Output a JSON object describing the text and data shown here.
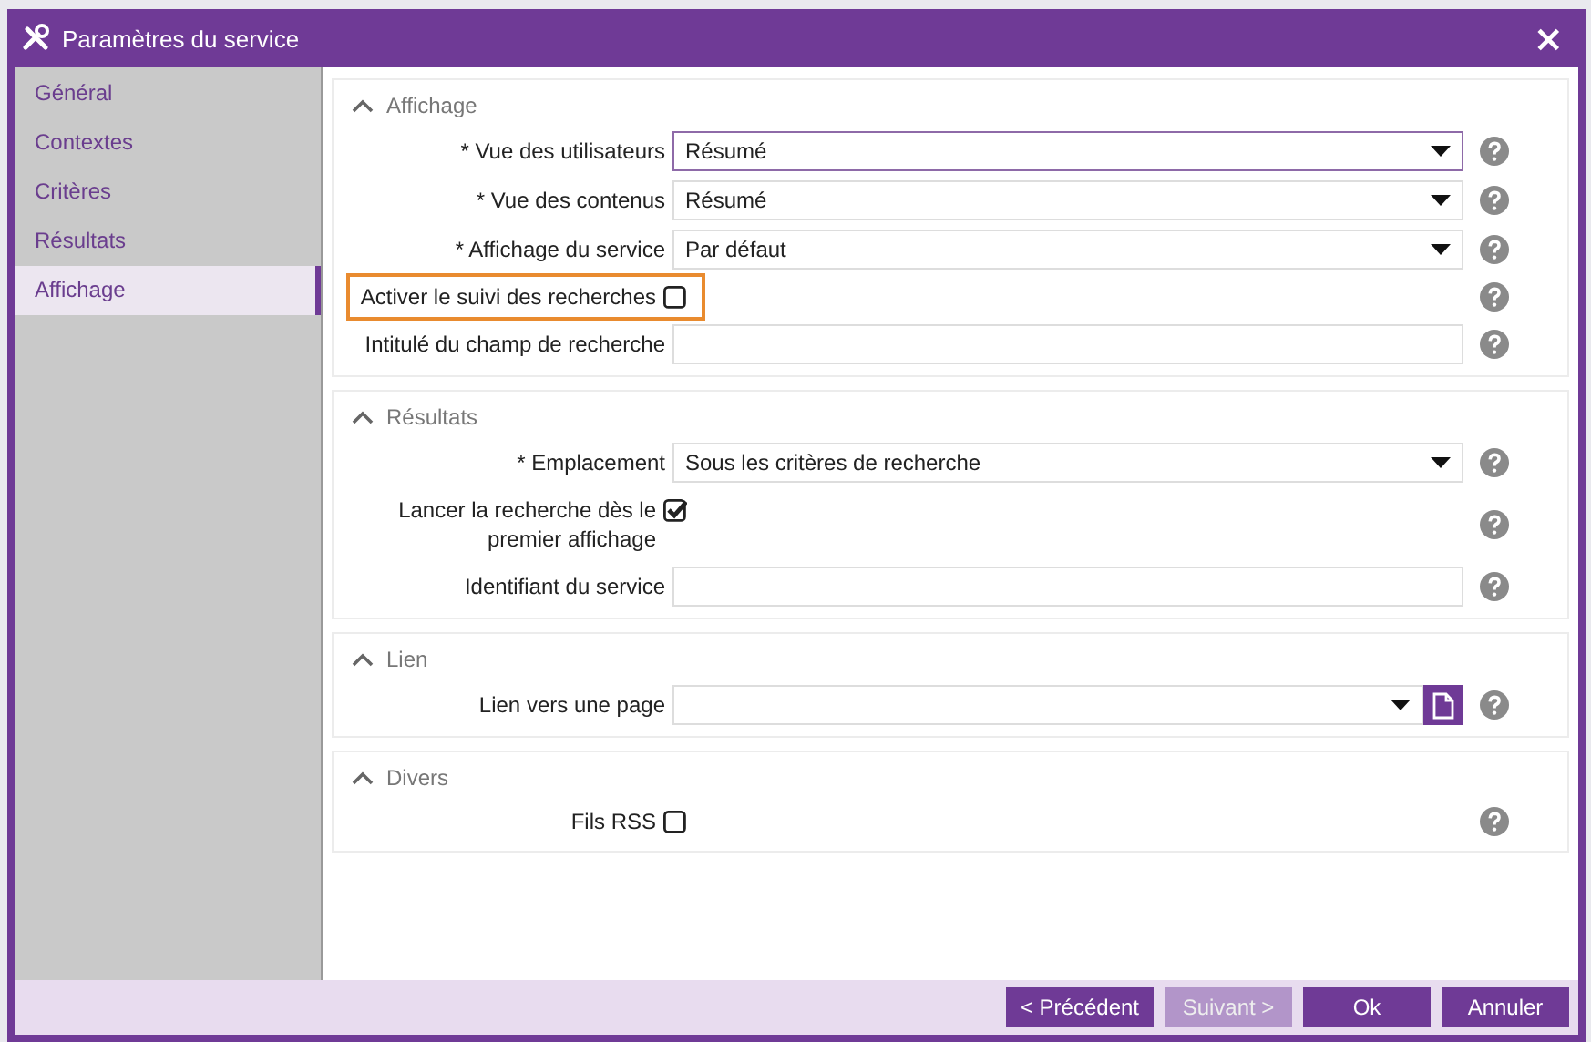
{
  "window": {
    "title": "Paramètres du service",
    "close": "×"
  },
  "sidebar": {
    "items": [
      {
        "label": "Général",
        "selected": false
      },
      {
        "label": "Contextes",
        "selected": false
      },
      {
        "label": "Critères",
        "selected": false
      },
      {
        "label": "Résultats",
        "selected": false
      },
      {
        "label": "Affichage",
        "selected": true
      }
    ]
  },
  "sections": [
    {
      "title": "Affichage",
      "expanded": true,
      "fields": [
        {
          "kind": "select",
          "label": "* Vue des utilisateurs",
          "value": "Résumé",
          "focused": true
        },
        {
          "kind": "select",
          "label": "* Vue des contenus",
          "value": "Résumé",
          "focused": false
        },
        {
          "kind": "select",
          "label": "* Affichage du service",
          "value": "Par défaut",
          "focused": false
        },
        {
          "kind": "checkbox",
          "label": "Activer le suivi des recherches",
          "checked": false,
          "highlighted": true
        },
        {
          "kind": "text",
          "label": "Intitulé du champ de recherche"
        }
      ]
    },
    {
      "title": "Résultats",
      "expanded": true,
      "fields": [
        {
          "kind": "select",
          "label": "* Emplacement",
          "value": "Sous les critères de recherche",
          "focused": false
        },
        {
          "kind": "checkbox",
          "label": "Lancer la recherche dès le premier affichage",
          "checked": true,
          "highlighted": false
        },
        {
          "kind": "text",
          "label": "Identifiant du service"
        }
      ]
    },
    {
      "title": "Lien",
      "expanded": true,
      "fields": [
        {
          "kind": "link",
          "label": "Lien vers une page"
        }
      ]
    },
    {
      "title": "Divers",
      "expanded": true,
      "fields": [
        {
          "kind": "checkbox",
          "label": "Fils RSS",
          "checked": false,
          "highlighted": false
        }
      ]
    }
  ],
  "buttons": [
    {
      "label": "< Précédent",
      "disabled": false
    },
    {
      "label": "Suivant >",
      "disabled": true
    },
    {
      "label": "Ok",
      "disabled": false
    },
    {
      "label": "Annuler",
      "disabled": false
    }
  ]
}
